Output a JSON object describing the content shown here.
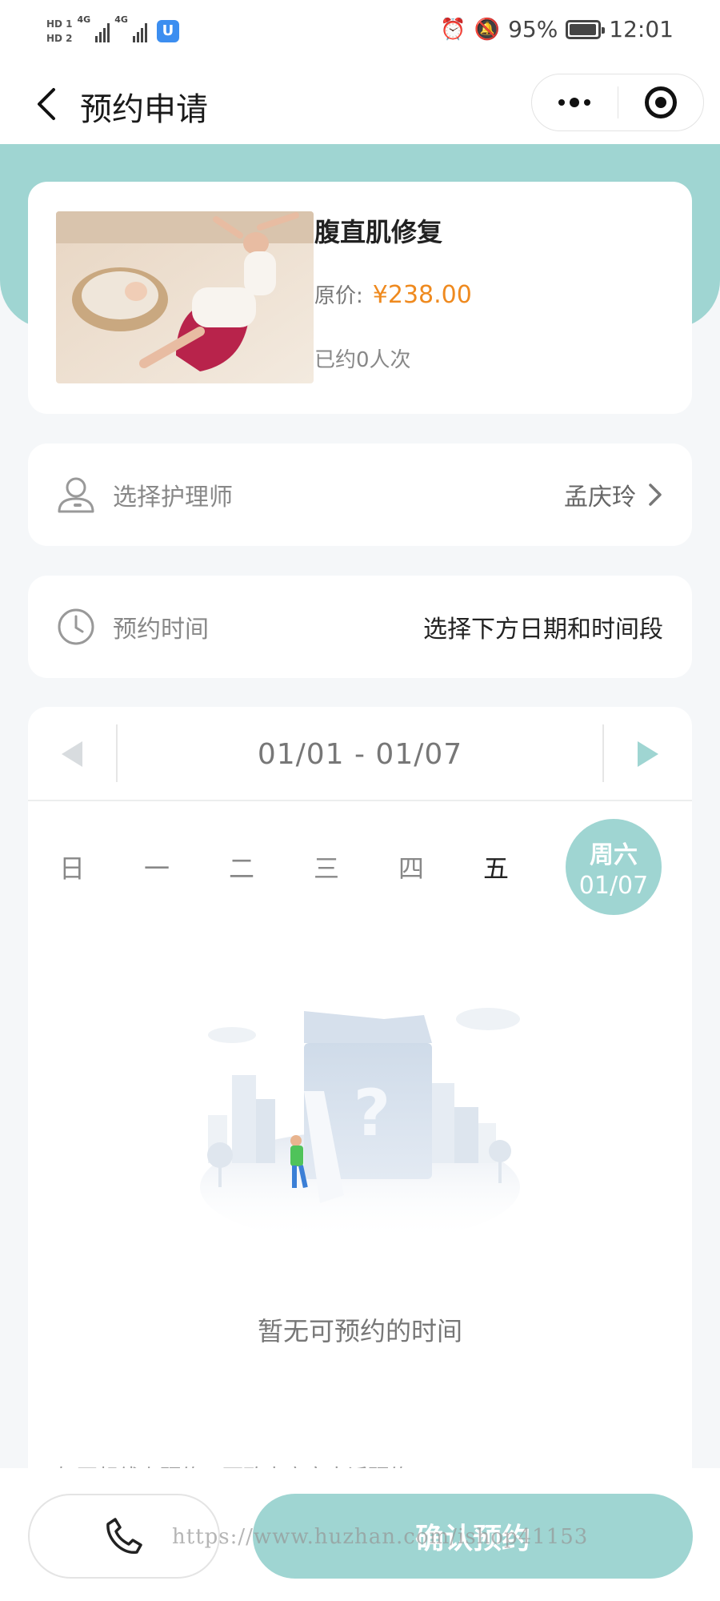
{
  "status_bar": {
    "hd1": "HD 1",
    "hd2": "HD 2",
    "net1": "4G",
    "net2": "4G",
    "battery": "95%",
    "time": "12:01",
    "battery_level": 0.95
  },
  "nav": {
    "title": "预约申请"
  },
  "product": {
    "name": "腹直肌修复",
    "price_label": "原价:",
    "price": "¥238.00",
    "booked": "已约0人次"
  },
  "nurse": {
    "label": "选择护理师",
    "value": "孟庆玲"
  },
  "booking_time": {
    "label": "预约时间",
    "value": "选择下方日期和时间段"
  },
  "calendar": {
    "range": "01/01 - 01/07",
    "weekdays": [
      "日",
      "一",
      "二",
      "三",
      "四",
      "五"
    ],
    "selected": {
      "name": "周六",
      "date": "01/07"
    },
    "empty_text": "暂无可预约的时间",
    "hint": "如不想线上预约，可致电商家电话预约"
  },
  "actions": {
    "confirm": "确认预约"
  },
  "watermark": "https://www.huzhan.com/ishop41153",
  "colors": {
    "teal": "#9fd5d2",
    "price_orange": "#ef8a1f"
  },
  "icons": {
    "back": "chevron-left-icon",
    "more": "more-dots-icon",
    "close": "target-icon",
    "nurse": "user-icon",
    "time": "clock-icon",
    "prev": "triangle-left-icon",
    "next": "triangle-right-icon",
    "arrow": "chevron-right-icon",
    "phone": "phone-icon"
  }
}
